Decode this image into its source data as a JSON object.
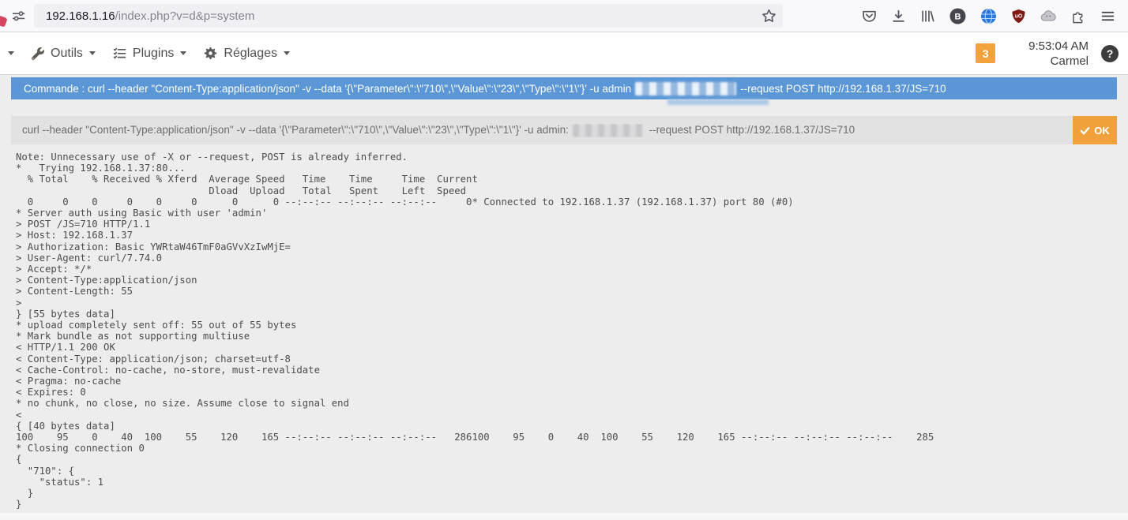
{
  "colors": {
    "banner_blue": "#5b97d7",
    "command_gray": "#e2e2e3",
    "ok_orange": "#f0a13c",
    "badge_orange": "#f2a33c"
  },
  "browser": {
    "url_host": "192.168.1.16",
    "url_path": "/index.php?v=d&p=system",
    "extension_b_label": "B",
    "ublock_label": "uO"
  },
  "header": {
    "menus": [
      {
        "label": "Outils"
      },
      {
        "label": "Plugins"
      },
      {
        "label": "Réglages"
      }
    ],
    "badge_count": "3",
    "time": "9:53:04 AM",
    "user_location": "Carmel",
    "help_glyph": "?"
  },
  "banner": {
    "before_secret": "Commande : curl --header \"Content-Type:application/json\" -v --data '{\\\"Parameter\\\":\\\"710\\\",\\\"Value\\\":\\\"23\\\",\\\"Type\\\":\\\"1\\\"}' -u admin",
    "after_secret": " --request POST http://192.168.1.37/JS=710"
  },
  "command": {
    "before_secret": "curl --header \"Content-Type:application/json\"  -v --data '{\\\"Parameter\\\":\\\"710\\\",\\\"Value\\\":\\\"23\\\",\\\"Type\\\":\\\"1\\\"}'  -u admin:",
    "after_secret": " --request POST http://192.168.1.37/JS=710",
    "ok_label": "OK"
  },
  "console": {
    "lines": [
      "Note: Unnecessary use of -X or --request, POST is already inferred.",
      "*   Trying 192.168.1.37:80...",
      "  % Total    % Received % Xferd  Average Speed   Time    Time     Time  Current",
      "                                 Dload  Upload   Total   Spent    Left  Speed",
      "  0     0    0     0    0     0      0      0 --:--:-- --:--:-- --:--:--     0* Connected to 192.168.1.37 (192.168.1.37) port 80 (#0)",
      "* Server auth using Basic with user 'admin'",
      "> POST /JS=710 HTTP/1.1",
      "> Host: 192.168.1.37",
      "> Authorization: Basic YWRtaW46TmF0aGVvXzIwMjE=",
      "> User-Agent: curl/7.74.0",
      "> Accept: */*",
      "> Content-Type:application/json",
      "> Content-Length: 55",
      ">",
      "} [55 bytes data]",
      "* upload completely sent off: 55 out of 55 bytes",
      "* Mark bundle as not supporting multiuse",
      "< HTTP/1.1 200 OK",
      "< Content-Type: application/json; charset=utf-8",
      "< Cache-Control: no-cache, no-store, must-revalidate",
      "< Pragma: no-cache",
      "< Expires: 0",
      "* no chunk, no close, no size. Assume close to signal end",
      "<",
      "{ [40 bytes data]",
      "100    95    0    40  100    55    120    165 --:--:-- --:--:-- --:--:--   286100    95    0    40  100    55    120    165 --:--:-- --:--:-- --:--:--    285",
      "* Closing connection 0",
      "{",
      "  \"710\": {",
      "    \"status\": 1",
      "  }",
      "}"
    ]
  }
}
